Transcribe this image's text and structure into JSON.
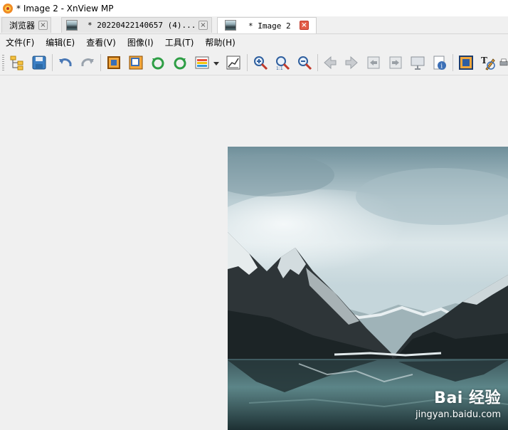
{
  "window": {
    "title": "* Image 2 - XnView MP"
  },
  "tabs": [
    {
      "label": "浏览器",
      "active": false,
      "close": "×"
    },
    {
      "label": "* 20220422140657 (4)...",
      "active": false,
      "close": "×"
    },
    {
      "label": "* Image 2",
      "active": true,
      "close": "×"
    }
  ],
  "menu": [
    "文件(F)",
    "编辑(E)",
    "查看(V)",
    "图像(I)",
    "工具(T)",
    "帮助(H)"
  ],
  "toolbar": {
    "icons": [
      "folder-tree-icon",
      "save-icon",
      "undo-icon",
      "redo-icon",
      "crop-icon",
      "resize-icon",
      "rotate-left-icon",
      "rotate-right-icon",
      "adjust-colors-icon",
      "dropdown-arrow-icon",
      "levels-icon",
      "zoom-in-icon",
      "zoom-actual-icon",
      "zoom-out-icon",
      "back-arrow-icon",
      "forward-arrow-icon",
      "previous-file-icon",
      "next-file-icon",
      "slideshow-icon",
      "info-icon",
      "fit-screen-icon",
      "text-tool-icon"
    ]
  },
  "watermark": {
    "logo": "Bai 经验",
    "url": "jingyan.baidu.com"
  },
  "colors": {
    "active_close": "#e35d48",
    "sky": "#b7cdd4",
    "mountain": "#2b3337"
  }
}
